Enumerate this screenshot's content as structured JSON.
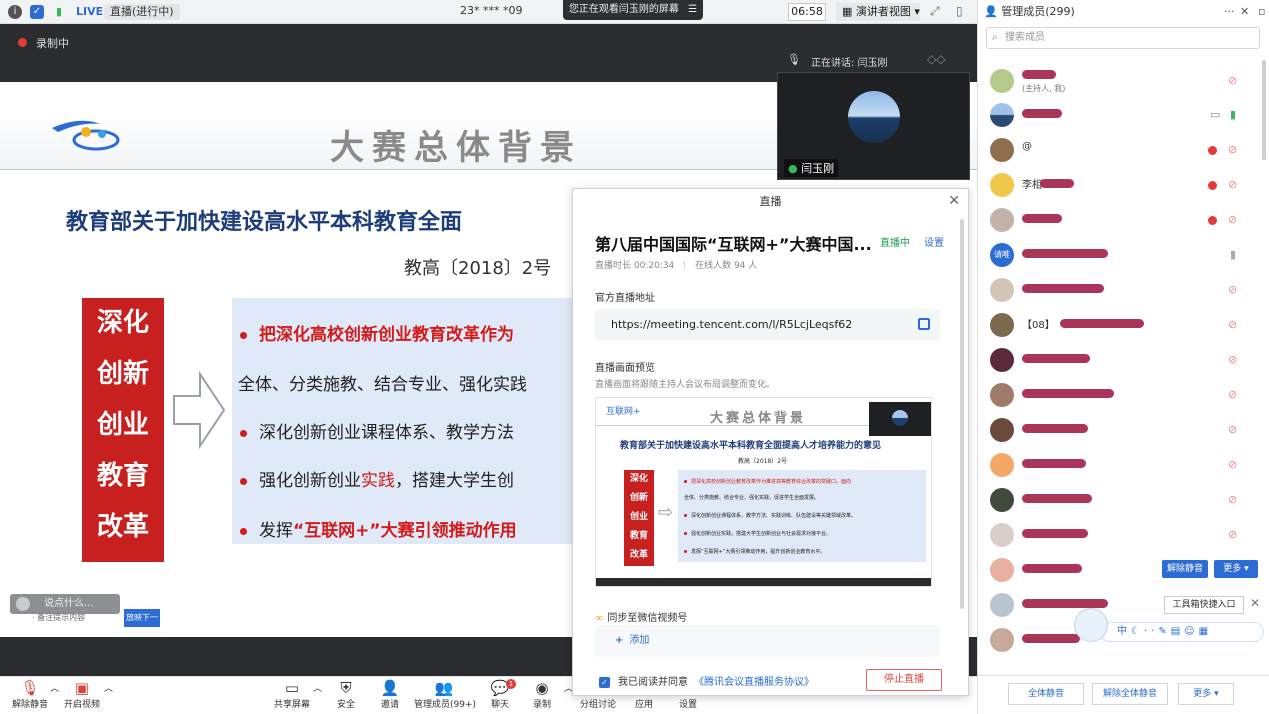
{
  "topbar": {
    "live_label": "LIVE",
    "status": "直播(进行中)",
    "meeting_id": "23* *** *09",
    "sharing_notice": "您正在观看闫玉刚的屏幕",
    "time": "06:58",
    "view_mode": "演讲者视图"
  },
  "recording": {
    "label": "录制中"
  },
  "slide": {
    "title": "大赛总体背景",
    "subtitle": "教育部关于加快建设高水平本科教育全面",
    "doc_no": "教高〔2018〕2号",
    "red_block": [
      "深化",
      "创新",
      "创业",
      "教育",
      "改革"
    ],
    "bullet1": "把深化高校创新创业教育改革作为",
    "bullet1b": "全体、分类施教、结合专业、强化实践",
    "bullet2": "深化创新创业课程体系、教学方法",
    "bullet3_a": "强化创新创业",
    "bullet3_b": "实践",
    "bullet3_c": "，搭建大学生创",
    "bullet4_a": "发挥",
    "bullet4_b": "“互联网+”大赛引领推动作用",
    "tip_placeholder": "说点什么...",
    "mini_text": "· 备注提示内容",
    "mini_btn": "放映下一"
  },
  "speaker": {
    "speaking_label": "正在讲话: 闫玉刚",
    "tile_name": "闫玉刚"
  },
  "live_dialog": {
    "header": "直播",
    "title": "第八届中国国际“互联网+”大赛中国...",
    "state": "直播中",
    "settings": "设置",
    "duration": "直播时长 00:20:34",
    "online": "在线人数 94 人",
    "addr_label": "官方直播地址",
    "url": "https://meeting.tencent.com/l/R5LcjLeqsf62",
    "preview_label": "直播画面预览",
    "preview_note": "直播画面将跟随主持人会议布局调整而变化。",
    "preview": {
      "logo": "互联网+",
      "title": "大赛总体背景",
      "sub": "教育部关于加快建设高水平本科教育全面提高人才培养能力的意见",
      "doc": "教高〔2018〕2号",
      "red": [
        "深化",
        "创新",
        "创业",
        "教育",
        "改革"
      ],
      "b1": "把深化高校创新创业教育改革作为推进高等教育综合改革的突破口，面向",
      "b1b": "全体、分类施教、结合专业、强化实践，促进学生全面发展。",
      "b2": "深化创新创业课程体系、教学方法、实践训练、队伍建设等关键领域改革。",
      "b3": "强化创新创业实践，搭建大学生创新创业与社会需求对接平台。",
      "b4": "发挥“互联网+”大赛引领推动作用，提升创新创业教育水平。"
    },
    "sync_label": "同步至微信视频号",
    "add_label": "添加",
    "agree_text": "我已阅读并同意",
    "agreement_link": "《腾讯会议直播服务协议》",
    "stop_button": "停止直播"
  },
  "toolbar": {
    "unmute": "解除静音",
    "video": "开启视频",
    "share": "共享屏幕",
    "security": "安全",
    "invite": "邀请",
    "members": "管理成员(99+)",
    "chat": "聊天",
    "chat_badge": "1",
    "record": "录制",
    "breakout": "分组讨论",
    "apps": "应用",
    "settings": "设置"
  },
  "members": {
    "header": "管理成员(299)",
    "search_placeholder": "搜索成员",
    "host_note": "(主持人, 我)",
    "visible_names": [
      "@",
      "李相"
    ],
    "avatar_text": "请唯",
    "bracket_name": "【08】",
    "unmute_btn": "解除静音",
    "more_btn": "更多",
    "quick_tool": "工具箱快捷入口",
    "footer_mute_all": "全体静音",
    "footer_unmute_all": "解除全体静音",
    "footer_more": "更多"
  }
}
